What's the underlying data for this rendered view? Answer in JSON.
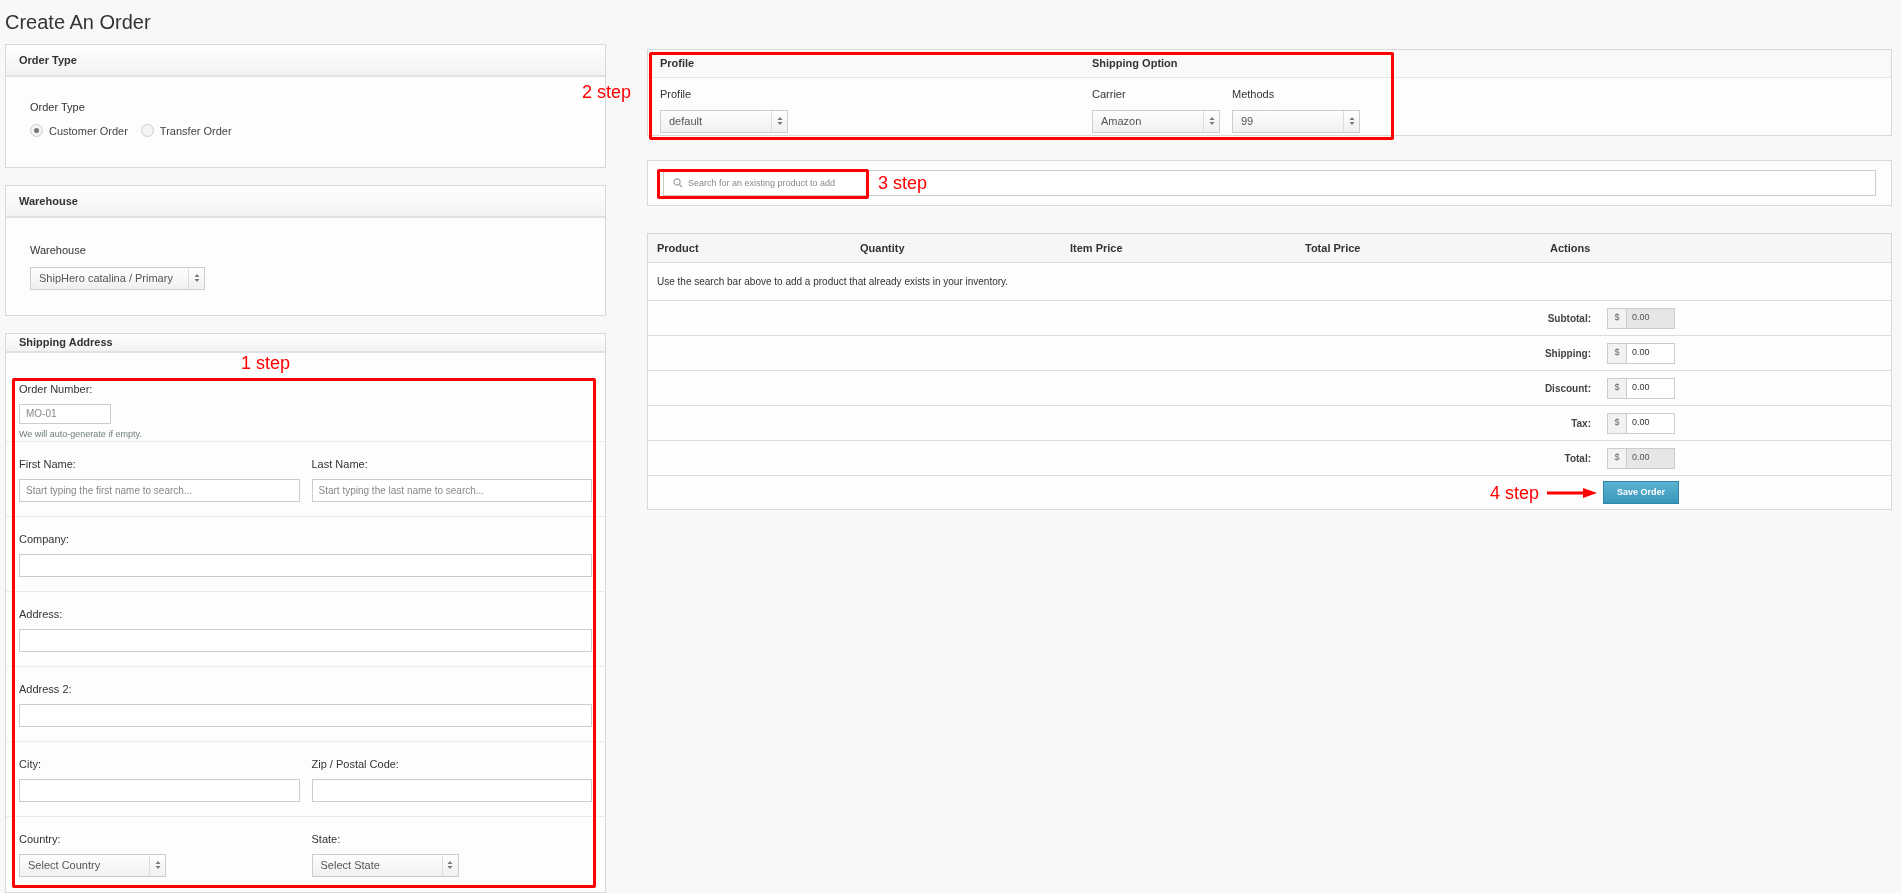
{
  "page_title": "Create An Order",
  "order_type_panel": {
    "title": "Order Type",
    "label": "Order Type",
    "options": [
      {
        "label": "Customer Order",
        "selected": true
      },
      {
        "label": "Transfer Order",
        "selected": false
      }
    ]
  },
  "warehouse_panel": {
    "title": "Warehouse",
    "label": "Warehouse",
    "select": "ShipHero catalina / Primary"
  },
  "shipping_address_panel": {
    "title": "Shipping Address",
    "rows": [
      [
        {
          "kind": "short_text",
          "label": "Order Number:",
          "placeholder": "MO-01",
          "help": "We will auto-generate if empty."
        }
      ],
      [
        {
          "kind": "text",
          "label": "First Name:",
          "placeholder": "Start typing the first name to search..."
        },
        {
          "kind": "text",
          "label": "Last Name:",
          "placeholder": "Start typing the last name to search..."
        }
      ],
      [
        {
          "kind": "text",
          "label": "Company:"
        }
      ],
      [
        {
          "kind": "text",
          "label": "Address:"
        }
      ],
      [
        {
          "kind": "text",
          "label": "Address 2:"
        }
      ],
      [
        {
          "kind": "text",
          "label": "City:"
        },
        {
          "kind": "text",
          "label": "Zip / Postal Code:"
        }
      ],
      [
        {
          "kind": "select",
          "label": "Country:",
          "value": "Select Country"
        },
        {
          "kind": "select",
          "label": "State:",
          "value": "Select State"
        }
      ]
    ]
  },
  "profile_panel": {
    "sections": [
      {
        "title": "Profile",
        "fields": [
          {
            "label": "Profile",
            "value": "default"
          }
        ]
      },
      {
        "title": "Shipping Option",
        "fields": [
          {
            "label": "Carrier",
            "value": "Amazon"
          },
          {
            "label": "Methods",
            "value": "99"
          }
        ]
      }
    ]
  },
  "product_search": {
    "placeholder": "Search for an existing product to add"
  },
  "order_table": {
    "columns": [
      "Product",
      "Quantity",
      "Item Price",
      "Total Price",
      "Actions"
    ],
    "empty_message": "Use the search bar above to add a product that already exists in your inventory.",
    "totals": [
      {
        "label": "Subtotal:",
        "currency": "$",
        "value": "0.00",
        "disabled": true
      },
      {
        "label": "Shipping:",
        "currency": "$",
        "value": "0.00",
        "disabled": false
      },
      {
        "label": "Discount:",
        "currency": "$",
        "value": "0.00",
        "disabled": false
      },
      {
        "label": "Tax:",
        "currency": "$",
        "value": "0.00",
        "disabled": false
      },
      {
        "label": "Total:",
        "currency": "$",
        "value": "0.00",
        "disabled": true
      }
    ],
    "save_button": "Save Order"
  },
  "annotations": [
    {
      "text": "1 step",
      "kind": "frame"
    },
    {
      "text": "2 step",
      "kind": "frame"
    },
    {
      "text": "3 step",
      "kind": "frame"
    },
    {
      "text": "4 step",
      "kind": "arrow"
    }
  ]
}
